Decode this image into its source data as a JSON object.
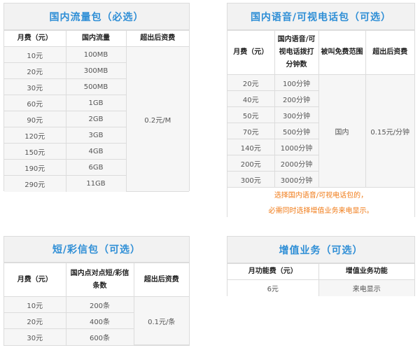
{
  "data_package": {
    "title": "国内流量包（必选）",
    "headers": [
      "月费（元）",
      "国内流量",
      "超出后资费"
    ],
    "rows": [
      [
        "10元",
        "100MB"
      ],
      [
        "20元",
        "300MB"
      ],
      [
        "30元",
        "500MB"
      ],
      [
        "60元",
        "1GB"
      ],
      [
        "90元",
        "2GB"
      ],
      [
        "120元",
        "3GB"
      ],
      [
        "150元",
        "4GB"
      ],
      [
        "190元",
        "6GB"
      ],
      [
        "290元",
        "11GB"
      ]
    ],
    "overage": "0.2元/M"
  },
  "voice_package": {
    "title": "国内语音/可视电话包（可选）",
    "headers": [
      "月费（元）",
      "国内语音/可视电话拨打分钟数",
      "被叫免费范围",
      "超出后资费"
    ],
    "rows": [
      [
        "20元",
        "100分钟"
      ],
      [
        "40元",
        "200分钟"
      ],
      [
        "50元",
        "300分钟"
      ],
      [
        "70元",
        "500分钟"
      ],
      [
        "140元",
        "1000分钟"
      ],
      [
        "200元",
        "2000分钟"
      ],
      [
        "300元",
        "3000分钟"
      ]
    ],
    "free_scope": "国内",
    "overage": "0.15元/分钟",
    "note_line1": "选择国内语音/可视电话包的，",
    "note_line2": "必需同时选择增值业务来电显示。"
  },
  "sms_package": {
    "title": "短/彩信包（可选）",
    "headers": [
      "月费（元）",
      "国内点对点短/彩信条数",
      "超出后资费"
    ],
    "rows": [
      [
        "10元",
        "200条"
      ],
      [
        "20元",
        "400条"
      ],
      [
        "30元",
        "600条"
      ]
    ],
    "overage": "0.1元/条"
  },
  "value_added": {
    "title": "增值业务（可选）",
    "headers": [
      "月功能费（元）",
      "增值业务功能"
    ],
    "rows": [
      [
        "6元",
        "来电显示"
      ]
    ]
  }
}
